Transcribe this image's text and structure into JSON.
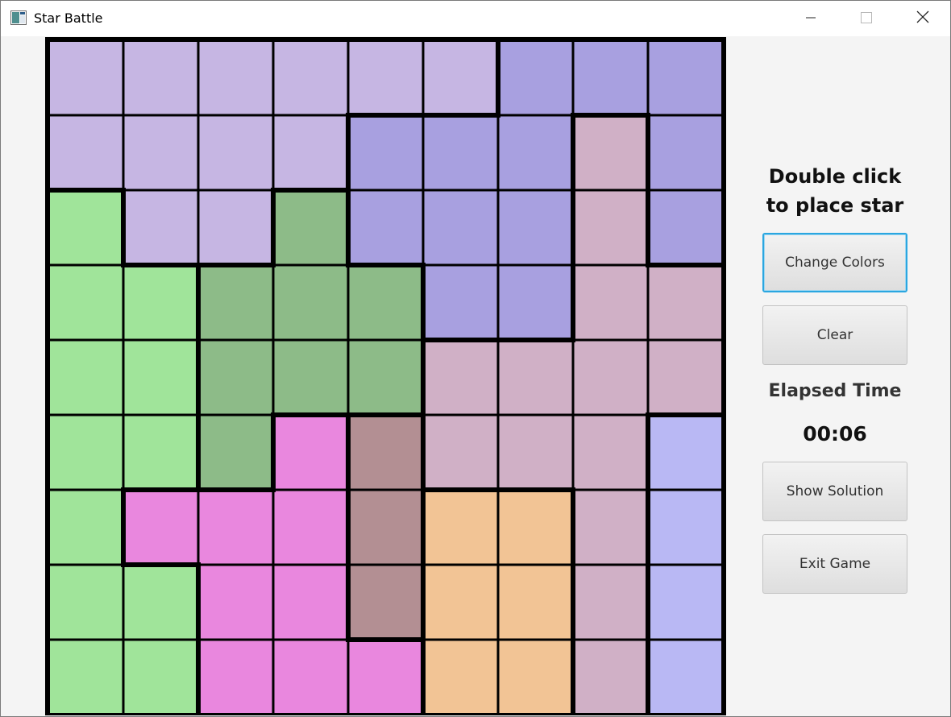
{
  "window": {
    "title": "Star Battle",
    "app_icon": "java-app-icon",
    "controls": [
      "minimize-icon",
      "maximize-icon",
      "close-icon"
    ]
  },
  "board": {
    "size": 9,
    "region_colors": {
      "A": "#c6b6e3",
      "B": "#a8a0e0",
      "C": "#d0b0c6",
      "D": "#a0e49a",
      "E": "#8dbb88",
      "F": "#e987de",
      "G": "#b38f93",
      "H": "#f2c495",
      "I": "#b9b8f4"
    },
    "regions": [
      [
        "A",
        "A",
        "A",
        "A",
        "A",
        "A",
        "B",
        "B",
        "B"
      ],
      [
        "A",
        "A",
        "A",
        "A",
        "B",
        "B",
        "B",
        "C",
        "B"
      ],
      [
        "D",
        "A",
        "A",
        "E",
        "B",
        "B",
        "B",
        "C",
        "B"
      ],
      [
        "D",
        "D",
        "E",
        "E",
        "E",
        "B",
        "B",
        "C",
        "C"
      ],
      [
        "D",
        "D",
        "E",
        "E",
        "E",
        "C",
        "C",
        "C",
        "C"
      ],
      [
        "D",
        "D",
        "E",
        "F",
        "G",
        "C",
        "C",
        "C",
        "I"
      ],
      [
        "D",
        "F",
        "F",
        "F",
        "G",
        "H",
        "H",
        "C",
        "I"
      ],
      [
        "D",
        "D",
        "F",
        "F",
        "G",
        "H",
        "H",
        "C",
        "I"
      ],
      [
        "D",
        "D",
        "F",
        "F",
        "F",
        "H",
        "H",
        "C",
        "I"
      ]
    ]
  },
  "side": {
    "instruction": "Double click\nto place star",
    "change_colors_label": "Change Colors",
    "clear_label": "Clear",
    "elapsed_label": "Elapsed Time",
    "elapsed_value": "00:06",
    "show_solution_label": "Show Solution",
    "exit_label": "Exit Game"
  }
}
